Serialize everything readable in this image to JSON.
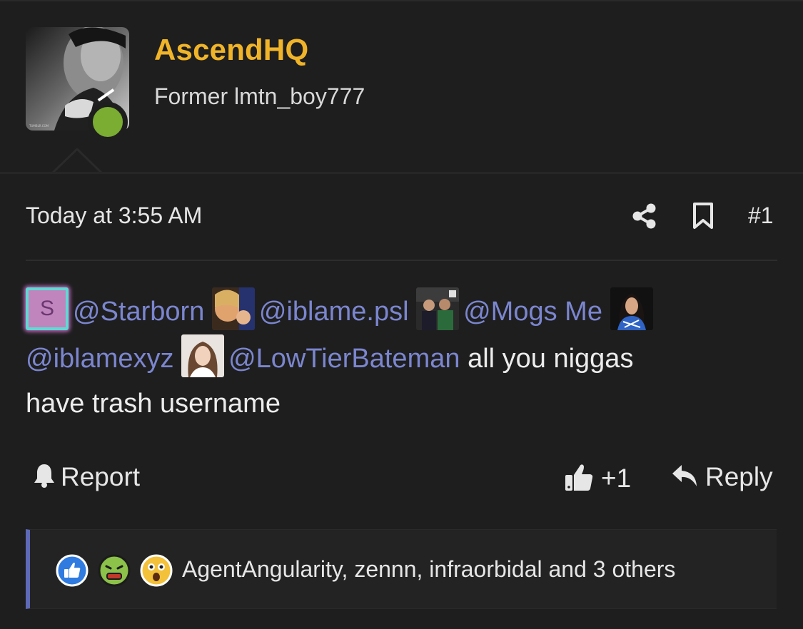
{
  "user": {
    "name": "AscendHQ",
    "title": "Former lmtn_boy777",
    "status_color": "#7aad31",
    "name_color": "#f0b429"
  },
  "post": {
    "date": "Today at 3:55 AM",
    "number": "#1"
  },
  "message": {
    "avatar_letter": "S",
    "mentions": [
      "@Starborn",
      "@iblame.psl",
      "@Mogs Me",
      "@iblamexyz",
      "@LowTierBateman"
    ],
    "text_after": "all you niggas",
    "text_line3": "have trash username",
    "mention_color": "#7b86cf"
  },
  "actions": {
    "report": "Report",
    "like_count": "+1",
    "reply": "Reply"
  },
  "reactions": {
    "icons": [
      "like-icon",
      "sick-face-icon",
      "shocked-face-icon"
    ],
    "text": "AgentAngularity, zennn, infraorbidal and 3 others",
    "accent": "#5e6ab8"
  }
}
